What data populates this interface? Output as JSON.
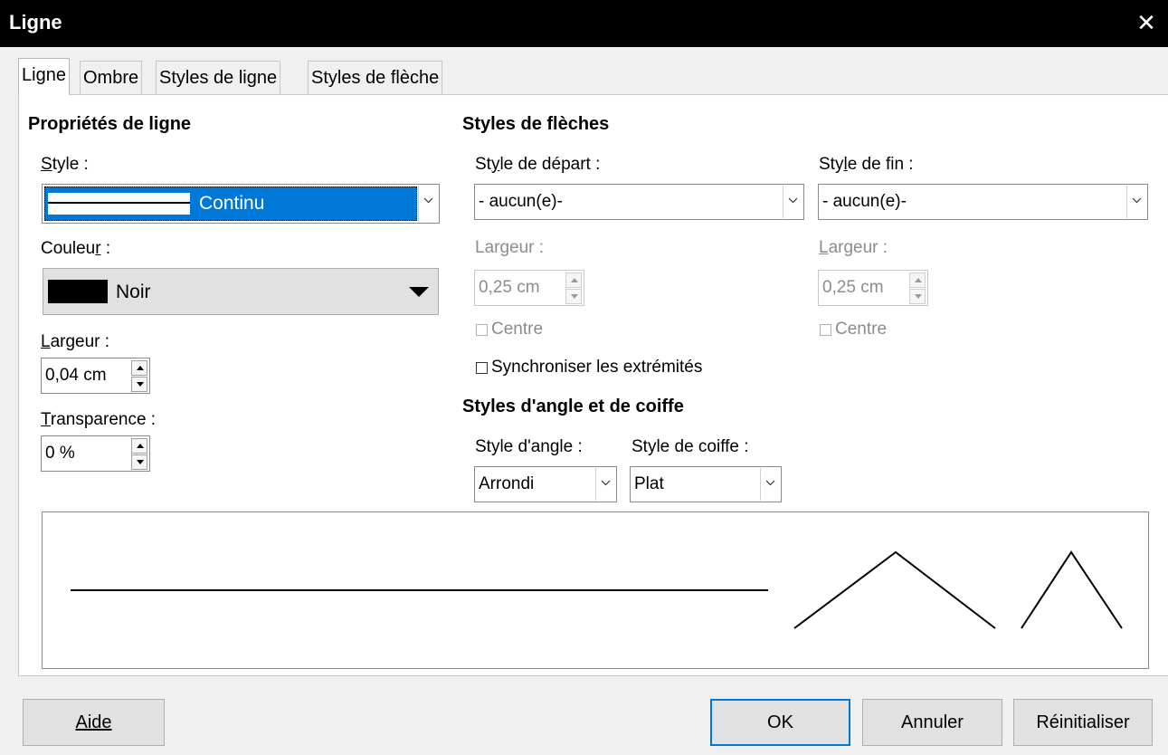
{
  "window": {
    "title": "Ligne"
  },
  "tabs": [
    {
      "label": "Ligne"
    },
    {
      "label": "Ombre"
    },
    {
      "label": "Styles de ligne"
    },
    {
      "label": "Styles de flèche"
    }
  ],
  "line_properties": {
    "heading": "Propriétés de ligne",
    "style_label": "Style :",
    "style_value": "Continu",
    "color_label": "Couleur :",
    "color_value": "Noir",
    "color_hex": "#000000",
    "width_label": "Largeur :",
    "width_value": "0,04 cm",
    "transparency_label": "Transparence :",
    "transparency_value": "0 %"
  },
  "arrow_styles": {
    "heading": "Styles de flèches",
    "start_style_label": "Style de départ :",
    "start_style_value": "- aucun(e)-",
    "end_style_label": "Style de fin :",
    "end_style_value": "- aucun(e)-",
    "start_width_label": "Largeur :",
    "start_width_value": "0,25 cm",
    "end_width_label": "Largeur :",
    "end_width_value": "0,25 cm",
    "start_center_label": "Centre",
    "end_center_label": "Centre",
    "sync_label": "Synchroniser les extrémités"
  },
  "corner_cap": {
    "heading": "Styles d'angle et de coiffe",
    "corner_label": "Style d'angle :",
    "corner_value": "Arrondi",
    "cap_label": "Style de coiffe :",
    "cap_value": "Plat"
  },
  "buttons": {
    "help": "Aide",
    "ok": "OK",
    "cancel": "Annuler",
    "reset": "Réinitialiser"
  },
  "accent_color": "#0078d7",
  "icons": {
    "close": "close-icon",
    "dropdown": "chevron-down-icon",
    "spin_up": "spin-up-icon",
    "spin_down": "spin-down-icon"
  }
}
